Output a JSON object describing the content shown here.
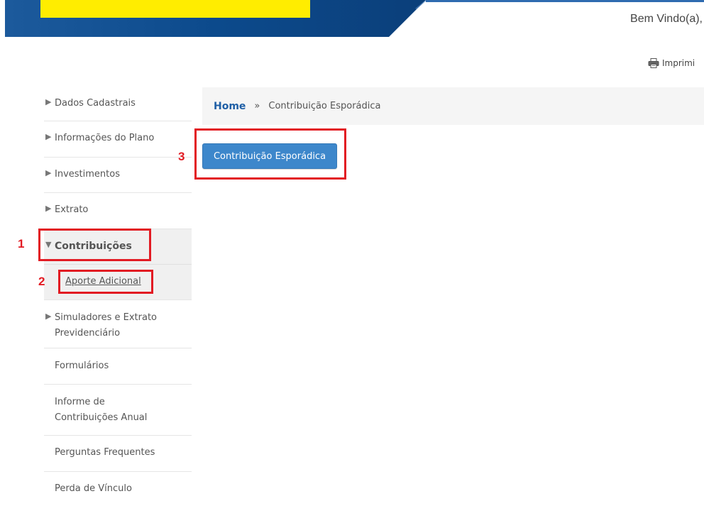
{
  "header": {
    "welcome_text": "Bem Vindo(a),",
    "brand_colors": {
      "blue": "#0a4a8e",
      "yellow": "#ffed00"
    }
  },
  "toolbar": {
    "print_label": "Imprimi",
    "print_icon": "printer-icon"
  },
  "sidebar": {
    "items": [
      {
        "label": "Dados Cadastrais",
        "icon": "caret-right-icon"
      },
      {
        "label": "Informações do Plano",
        "icon": "caret-right-icon"
      },
      {
        "label": "Investimentos",
        "icon": "caret-right-icon"
      },
      {
        "label": "Extrato",
        "icon": "caret-right-icon"
      },
      {
        "label": "Contribuições",
        "icon": "caret-down-icon",
        "expanded": true,
        "children": [
          {
            "label": "Aporte Adicional"
          }
        ]
      },
      {
        "label_line1": "Simuladores e Extrato",
        "label_line2": "Previdenciário",
        "icon": "caret-right-icon"
      },
      {
        "label": "Formulários"
      },
      {
        "label_line1": "Informe de",
        "label_line2": "Contribuições Anual"
      },
      {
        "label": "Perguntas Frequentes"
      },
      {
        "label": "Perda de Vínculo"
      }
    ]
  },
  "breadcrumb": {
    "home": "Home",
    "separator": "»",
    "current": "Contribuição Esporádica"
  },
  "main": {
    "button_label": "Contribuição Esporádica",
    "button_color": "#3d87cb"
  },
  "annotations": {
    "color": "#e21b23",
    "steps": [
      "1",
      "2",
      "3"
    ]
  }
}
